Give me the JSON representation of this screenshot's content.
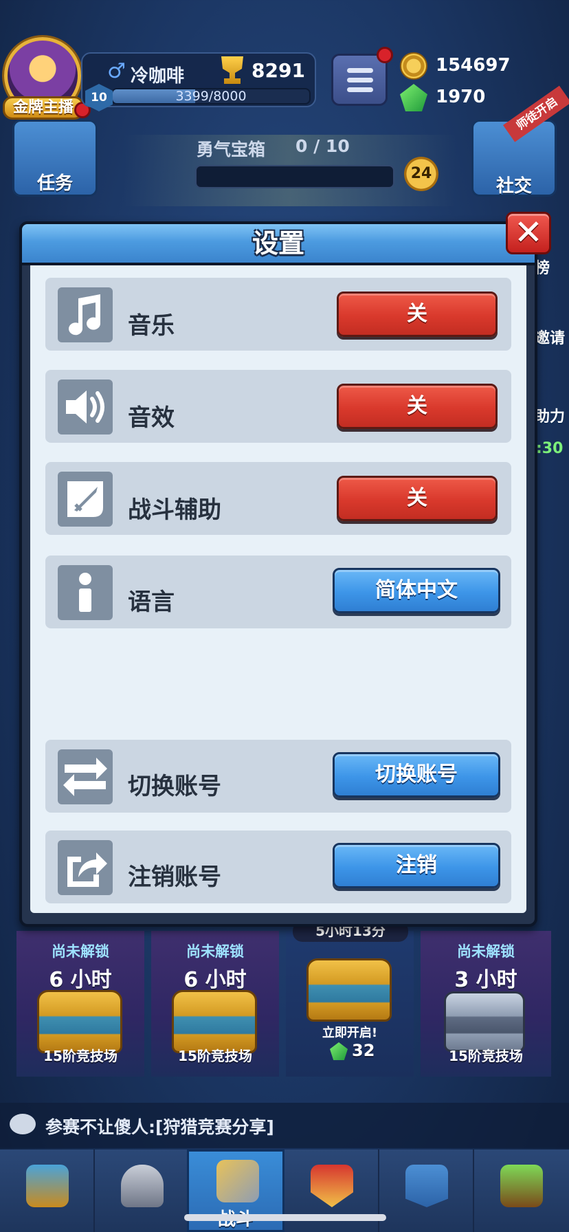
{
  "hud": {
    "player_name": "冷咖啡",
    "trophies": "8291",
    "level": "10",
    "xp_text": "3399/8000",
    "xp_fraction": 0.42,
    "avatar_badge": "金牌主播",
    "coins": "154697",
    "gems": "1970",
    "task_label": "任务",
    "social_label": "社交",
    "social_ribbon": "师徒开启",
    "chest_title": "勇气宝箱",
    "chest_progress": "0 / 10",
    "chest_count": "24"
  },
  "edge": {
    "r1": "榜",
    "r2": "邀请",
    "r3": "助力",
    "timer": ":30"
  },
  "settings": {
    "title": "设置",
    "close_symbol": "✕",
    "rows": [
      {
        "label": "音乐",
        "button": "关",
        "icon": "music-note-icon"
      },
      {
        "label": "音效",
        "button": "关",
        "icon": "speaker-icon"
      },
      {
        "label": "战斗辅助",
        "button": "关",
        "icon": "sword-icon"
      },
      {
        "label": "语言",
        "button": "简体中文",
        "icon": "info-icon"
      },
      {
        "label": "切换账号",
        "button": "切换账号",
        "icon": "switch-arrows-icon"
      },
      {
        "label": "注销账号",
        "button": "注销",
        "icon": "share-export-icon"
      }
    ]
  },
  "slots": [
    {
      "status": "尚未解锁",
      "time": "6 小时",
      "arena": "15阶竞技场"
    },
    {
      "status": "尚未解锁",
      "time": "6 小时",
      "arena": "15阶竞技场"
    },
    {
      "timer": "5小时13分",
      "open_now": "立即开启!",
      "gem_cost": "32"
    },
    {
      "status": "尚未解锁",
      "time": "3 小时",
      "arena": "15阶竞技场"
    }
  ],
  "chat": {
    "text": "参赛不让傻人:[狩猎竞赛分享]"
  },
  "nav": {
    "battle_label": "战斗"
  },
  "colors": {
    "red_button": "#d9392c",
    "blue_button": "#3d95e8",
    "dialog_bg": "#e8f1f8",
    "row_bg": "#cbd6e2"
  }
}
